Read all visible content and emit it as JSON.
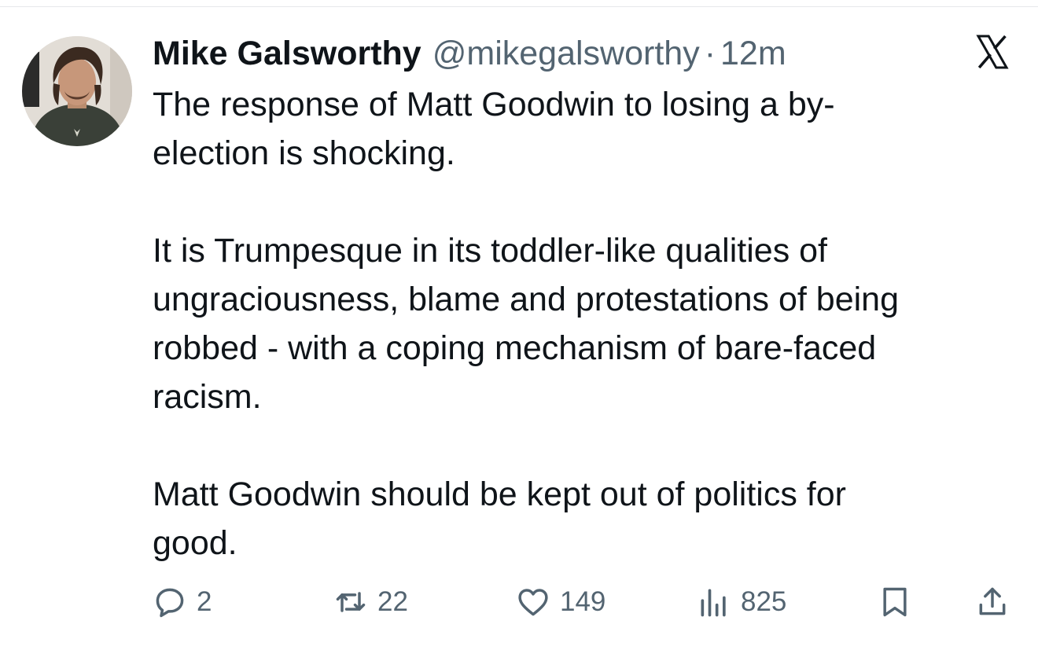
{
  "tweet": {
    "author": {
      "display_name": "Mike Galsworthy",
      "handle": "@mikegalsworthy"
    },
    "separator": "·",
    "timestamp": "12m",
    "paragraphs": [
      "The response of Matt Goodwin to losing a by-\nelection is shocking.",
      "It is Trumpesque in its toddler-like qualities of\nungraciousness, blame and protestations of being\nrobbed - with a coping mechanism of bare-faced\nracism.",
      "Matt Goodwin should be kept out of politics for\ngood."
    ],
    "actions": {
      "reply_count": "2",
      "repost_count": "22",
      "like_count": "149",
      "view_count": "825"
    }
  },
  "icons": {
    "brand": "x-logo-icon",
    "reply": "reply-icon",
    "repost": "repost-icon",
    "like": "heart-icon",
    "views": "views-icon",
    "bookmark": "bookmark-icon",
    "share": "share-icon"
  },
  "colors": {
    "text_primary": "#0f1419",
    "text_secondary": "#536471",
    "background": "#ffffff"
  }
}
